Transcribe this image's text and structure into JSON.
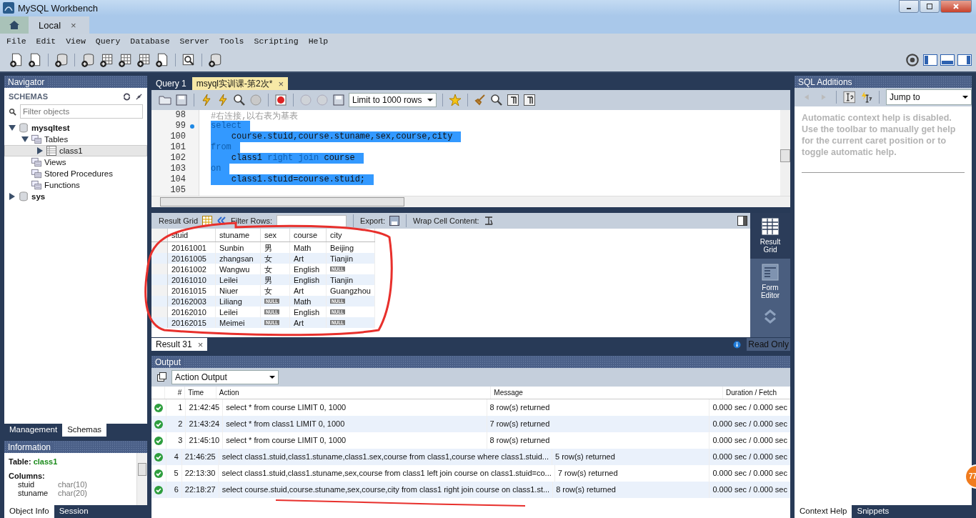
{
  "window": {
    "title": "MySQL Workbench"
  },
  "connection_tabs": [
    {
      "label": "Local",
      "selected": true,
      "close": "×"
    }
  ],
  "menu": [
    "File",
    "Edit",
    "View",
    "Query",
    "Database",
    "Server",
    "Tools",
    "Scripting",
    "Help"
  ],
  "navigator": {
    "title": "Navigator",
    "section": "SCHEMAS",
    "filter": {
      "placeholder": "Filter objects"
    },
    "tree": [
      {
        "label": "mysqltest",
        "kind": "schema",
        "expanded": true,
        "selected": false,
        "children": [
          {
            "label": "Tables",
            "kind": "folder",
            "expanded": true,
            "selected": false,
            "children": [
              {
                "label": "class1",
                "kind": "table",
                "expanded": false,
                "selected": true
              }
            ]
          },
          {
            "label": "Views",
            "kind": "folder",
            "selected": false
          },
          {
            "label": "Stored Procedures",
            "kind": "folder",
            "selected": false
          },
          {
            "label": "Functions",
            "kind": "folder",
            "selected": false
          }
        ]
      },
      {
        "label": "sys",
        "kind": "schema",
        "expanded": false,
        "selected": false
      }
    ],
    "tabs": [
      {
        "label": "Management",
        "selected": false
      },
      {
        "label": "Schemas",
        "selected": true
      }
    ]
  },
  "information": {
    "title": "Information",
    "table_label": "Table:",
    "table_name": "class1",
    "columns_label": "Columns:",
    "columns": [
      {
        "name": "stuid",
        "type": "char(10)"
      },
      {
        "name": "stuname",
        "type": "char(20)"
      }
    ],
    "tabs": [
      {
        "label": "Object Info",
        "selected": true
      },
      {
        "label": "Session",
        "selected": false
      }
    ]
  },
  "query_tabs": [
    {
      "label": "Query 1",
      "selected": false
    },
    {
      "label": "msyql实训课-第2次*",
      "selected": true,
      "close": "×"
    }
  ],
  "limit_select": "Limit to 1000 rows",
  "editor": {
    "lines": [
      {
        "number": "98",
        "marker": false,
        "selected": false,
        "segments": [
          {
            "kind": "comment",
            "text": "#右连接,以右表为基表"
          }
        ]
      },
      {
        "number": "99",
        "marker": true,
        "selected": true,
        "segments": [
          {
            "kind": "keyword",
            "text": "select"
          }
        ]
      },
      {
        "number": "100",
        "marker": false,
        "selected": true,
        "segments": [
          {
            "kind": "plain",
            "text": "    course.stuid,course.stuname,sex,course,city"
          }
        ]
      },
      {
        "number": "101",
        "marker": false,
        "selected": true,
        "segments": [
          {
            "kind": "keyword",
            "text": "from"
          }
        ]
      },
      {
        "number": "102",
        "marker": false,
        "selected": true,
        "segments": [
          {
            "kind": "plain",
            "text": "    class1 "
          },
          {
            "kind": "keyword",
            "text": "right join"
          },
          {
            "kind": "plain",
            "text": " course"
          }
        ]
      },
      {
        "number": "103",
        "marker": false,
        "selected": true,
        "segments": [
          {
            "kind": "keyword",
            "text": "on"
          }
        ]
      },
      {
        "number": "104",
        "marker": false,
        "selected": true,
        "segments": [
          {
            "kind": "plain",
            "text": "    class1.stuid=course.stuid;"
          }
        ]
      },
      {
        "number": "105",
        "marker": false,
        "selected": false
      }
    ]
  },
  "result_toolbar": {
    "grid_label": "Result Grid",
    "filter_label": "Filter Rows:",
    "export_label": "Export:",
    "wrap_label": "Wrap Cell Content:"
  },
  "result_grid": {
    "columns": [
      "stuid",
      "stuname",
      "sex",
      "course",
      "city"
    ],
    "rows": [
      [
        {
          "kind": "value",
          "text": "20161001"
        },
        {
          "kind": "value",
          "text": "Sunbin"
        },
        {
          "kind": "value",
          "text": "男"
        },
        {
          "kind": "value",
          "text": "Math"
        },
        {
          "kind": "value",
          "text": "Beijing"
        }
      ],
      [
        {
          "kind": "value",
          "text": "20161005"
        },
        {
          "kind": "value",
          "text": "zhangsan"
        },
        {
          "kind": "value",
          "text": "女"
        },
        {
          "kind": "value",
          "text": "Art"
        },
        {
          "kind": "value",
          "text": "Tianjin"
        }
      ],
      [
        {
          "kind": "value",
          "text": "20161002"
        },
        {
          "kind": "value",
          "text": "Wangwu"
        },
        {
          "kind": "value",
          "text": "女"
        },
        {
          "kind": "value",
          "text": "English"
        },
        {
          "kind": "null",
          "text": "NULL"
        }
      ],
      [
        {
          "kind": "value",
          "text": "20161010"
        },
        {
          "kind": "value",
          "text": "Leilei"
        },
        {
          "kind": "value",
          "text": "男"
        },
        {
          "kind": "value",
          "text": "English"
        },
        {
          "kind": "value",
          "text": "Tianjin"
        }
      ],
      [
        {
          "kind": "value",
          "text": "20161015"
        },
        {
          "kind": "value",
          "text": "Niuer"
        },
        {
          "kind": "value",
          "text": "女"
        },
        {
          "kind": "value",
          "text": "Art"
        },
        {
          "kind": "value",
          "text": "Guangzhou"
        }
      ],
      [
        {
          "kind": "value",
          "text": "20162003"
        },
        {
          "kind": "value",
          "text": "Liliang"
        },
        {
          "kind": "null",
          "text": "NULL"
        },
        {
          "kind": "value",
          "text": "Math"
        },
        {
          "kind": "null",
          "text": "NULL"
        }
      ],
      [
        {
          "kind": "value",
          "text": "20162010"
        },
        {
          "kind": "value",
          "text": "Leilei"
        },
        {
          "kind": "null",
          "text": "NULL"
        },
        {
          "kind": "value",
          "text": "English"
        },
        {
          "kind": "null",
          "text": "NULL"
        }
      ],
      [
        {
          "kind": "value",
          "text": "20162015"
        },
        {
          "kind": "value",
          "text": "Meimei"
        },
        {
          "kind": "null",
          "text": "NULL"
        },
        {
          "kind": "value",
          "text": "Art"
        },
        {
          "kind": "null",
          "text": "NULL"
        }
      ]
    ]
  },
  "view_buttons": [
    {
      "label": "Result Grid",
      "selected": true
    },
    {
      "label": "Form Editor",
      "selected": false
    }
  ],
  "result_tabs": [
    {
      "label": "Result 31",
      "close": "×"
    }
  ],
  "read_only": "Read Only",
  "output": {
    "title": "Output",
    "select": "Action Output",
    "columns": [
      "#",
      "Time",
      "Action",
      "Message",
      "Duration / Fetch"
    ],
    "rows": [
      {
        "kind": "success",
        "index": "1",
        "time": "21:42:45",
        "action": "select * from course LIMIT 0, 1000",
        "message": "8 row(s) returned",
        "duration": "0.000 sec / 0.000 sec"
      },
      {
        "kind": "success",
        "index": "2",
        "time": "21:43:24",
        "action": "select * from class1 LIMIT 0, 1000",
        "message": "7 row(s) returned",
        "duration": "0.000 sec / 0.000 sec"
      },
      {
        "kind": "success",
        "index": "3",
        "time": "21:45:10",
        "action": "select * from course LIMIT 0, 1000",
        "message": "8 row(s) returned",
        "duration": "0.000 sec / 0.000 sec"
      },
      {
        "kind": "success",
        "index": "4",
        "time": "21:46:25",
        "action": "select  class1.stuid,class1.stuname,class1.sex,course from  class1,course  where  class1.stuid...",
        "message": "5 row(s) returned",
        "duration": "0.000 sec / 0.000 sec"
      },
      {
        "kind": "success",
        "index": "5",
        "time": "22:13:30",
        "action": "select  class1.stuid,class1.stuname,sex,course  from class1 left join course  on  class1.stuid=co...",
        "message": "7 row(s) returned",
        "duration": "0.000 sec / 0.000 sec"
      },
      {
        "kind": "success",
        "index": "6",
        "time": "22:18:27",
        "action": "select  course.stuid,course.stuname,sex,course,city  from class1 right join course  on  class1.st...",
        "message": "8 row(s) returned",
        "duration": "0.000 sec / 0.000 sec"
      }
    ]
  },
  "sql_additions": {
    "title": "SQL Additions",
    "jump_to": "Jump to",
    "help_text": "Automatic context help is disabled. Use the toolbar to manually get help for the current caret position or to toggle automatic help.",
    "tabs": [
      {
        "label": "Context Help",
        "selected": true
      },
      {
        "label": "Snippets",
        "selected": false
      }
    ]
  },
  "badge": "77"
}
